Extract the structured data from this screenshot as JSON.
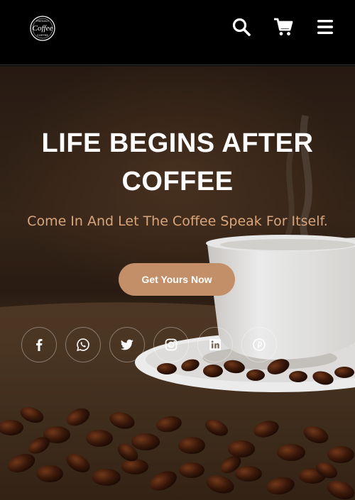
{
  "header": {
    "logo_text": "Coffee",
    "logo_top_text": "FRESHLY",
    "logo_bottom_text": "COFFEE",
    "icons": [
      "search-icon",
      "cart-icon",
      "menu-icon"
    ]
  },
  "hero": {
    "title": "LIFE BEGINS AFTER COFFEE",
    "subtitle": "Come In And Let The Coffee Speak For Itself.",
    "cta_label": "Get Yours Now"
  },
  "social": {
    "icons": [
      "facebook-icon",
      "whatsapp-icon",
      "twitter-icon",
      "instagram-icon",
      "linkedin-icon",
      "pinterest-icon"
    ]
  },
  "colors": {
    "accent": "#c38f68",
    "subtitle": "#d8a67c",
    "navbar": "#000000",
    "text": "#ffffff"
  }
}
